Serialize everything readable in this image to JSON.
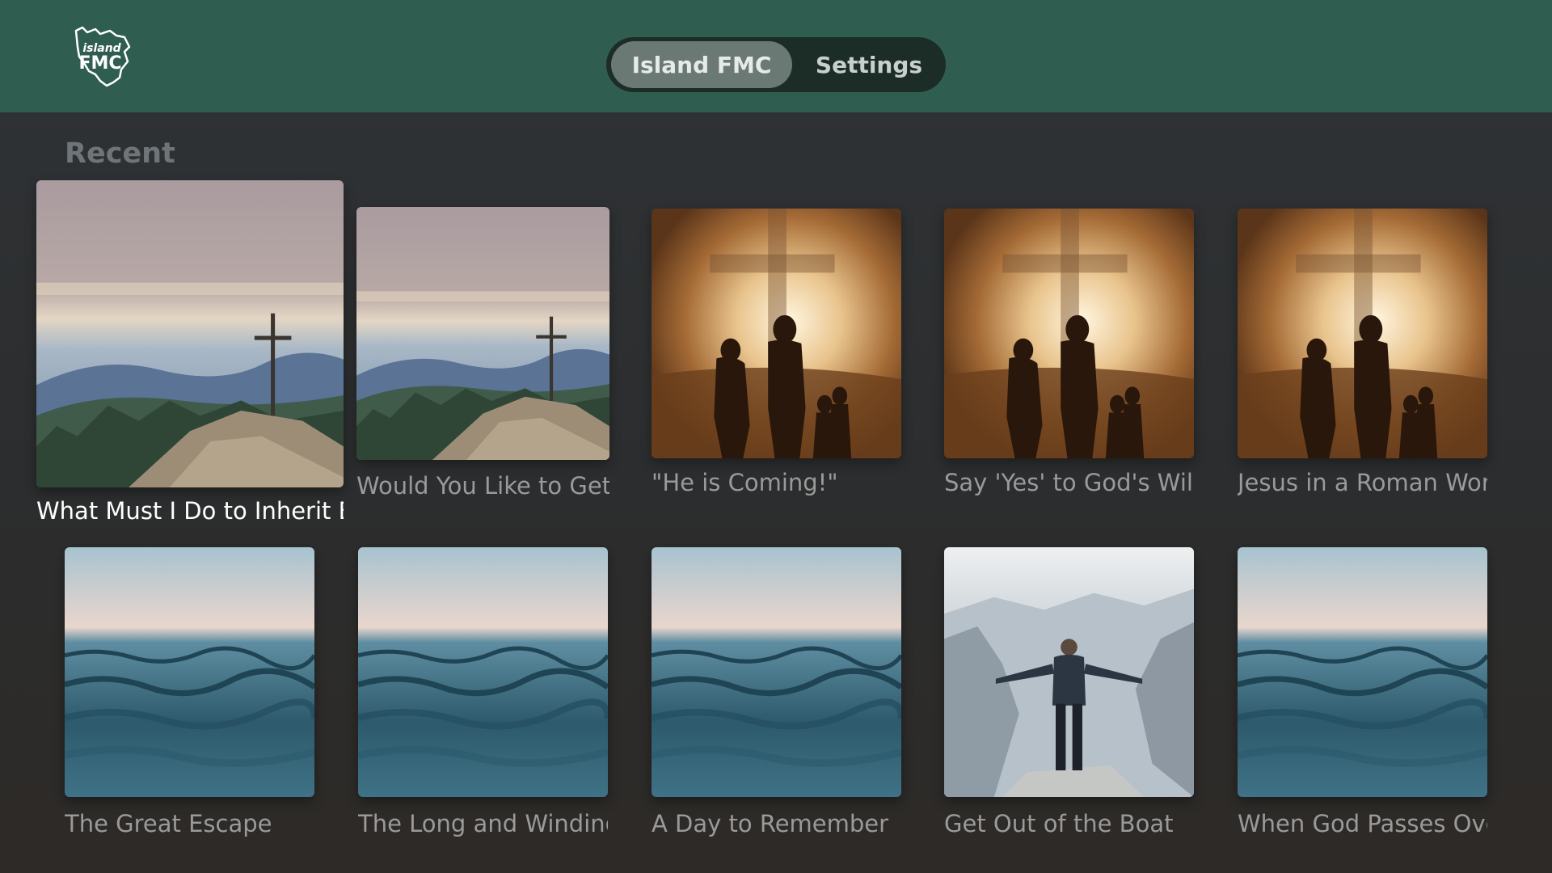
{
  "app": {
    "logo_text_line1": "island",
    "logo_text_line2": "FMC"
  },
  "tabs": [
    {
      "label": "Island FMC",
      "selected": true
    },
    {
      "label": "Settings",
      "selected": false
    }
  ],
  "section": {
    "title": "Recent"
  },
  "items": [
    {
      "title": "What Must I Do to Inherit Et",
      "artwork": "mountain-cross",
      "focused": true
    },
    {
      "title": "Would You Like to Get",
      "artwork": "mountain-cross",
      "focused": false
    },
    {
      "title": "\"He is Coming!\"",
      "artwork": "family-cross",
      "focused": false
    },
    {
      "title": "Say 'Yes' to God's Will",
      "artwork": "family-cross",
      "focused": false
    },
    {
      "title": "Jesus in a Roman Worl",
      "artwork": "family-cross",
      "focused": false
    },
    {
      "title": "The Great Escape",
      "artwork": "ocean-waves",
      "focused": false
    },
    {
      "title": "The Long and Winding",
      "artwork": "ocean-waves",
      "focused": false
    },
    {
      "title": "A Day to Remember",
      "artwork": "ocean-waves",
      "focused": false
    },
    {
      "title": "Get Out of the Boat",
      "artwork": "man-on-cliff",
      "focused": false
    },
    {
      "title": "When God Passes Ove",
      "artwork": "ocean-waves",
      "focused": false
    }
  ]
}
